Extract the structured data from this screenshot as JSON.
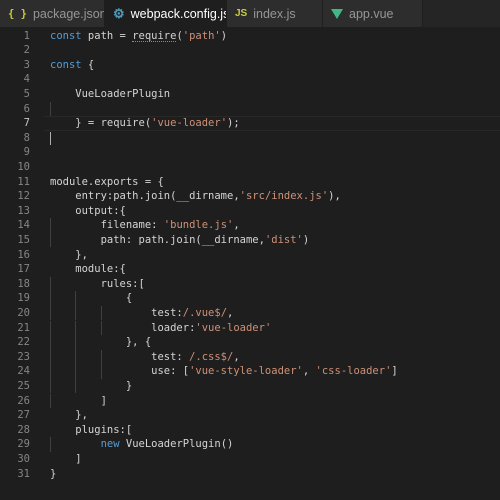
{
  "tabs": [
    {
      "label": "package.json",
      "icon": "{ }",
      "icon_name": "json-icon",
      "active": false
    },
    {
      "label": "webpack.config.js",
      "icon": "⚙",
      "icon_name": "gear-icon",
      "active": true
    },
    {
      "label": "index.js",
      "icon": "JS",
      "icon_name": "js-icon",
      "active": false
    },
    {
      "label": "app.vue",
      "icon": "",
      "icon_name": "vue-icon",
      "active": false
    }
  ],
  "editor": {
    "current_line": 7,
    "lines": [
      [
        [
          "kw",
          "const"
        ],
        [
          "pl",
          " path = "
        ],
        [
          "pl",
          "require"
        ],
        [
          "pl",
          "("
        ],
        [
          "str",
          "'path'"
        ],
        [
          "pl",
          ")"
        ]
      ],
      [],
      [
        [
          "kw",
          "const"
        ],
        [
          "pl",
          " {"
        ]
      ],
      [],
      [
        [
          "pl",
          "    VueLoaderPlugin"
        ]
      ],
      [],
      [
        [
          "pl",
          "    } = require("
        ],
        [
          "str",
          "'vue-loader'"
        ],
        [
          "pl",
          ");"
        ]
      ],
      [],
      [],
      [],
      [
        [
          "pl",
          "module.exports = {"
        ]
      ],
      [
        [
          "pl",
          "    entry:path.join(__dirname,"
        ],
        [
          "str",
          "'src/index.js'"
        ],
        [
          "pl",
          "),"
        ]
      ],
      [
        [
          "pl",
          "    output:{"
        ]
      ],
      [
        [
          "pl",
          "        filename: "
        ],
        [
          "str",
          "'bundle.js'"
        ],
        [
          "pl",
          ","
        ]
      ],
      [
        [
          "pl",
          "        path: path.join(__dirname,"
        ],
        [
          "str",
          "'dist'"
        ],
        [
          "pl",
          ")"
        ]
      ],
      [
        [
          "pl",
          "    },"
        ]
      ],
      [
        [
          "pl",
          "    module:{"
        ]
      ],
      [
        [
          "pl",
          "        rules:["
        ]
      ],
      [
        [
          "pl",
          "            {"
        ]
      ],
      [
        [
          "pl",
          "                test:"
        ],
        [
          "str",
          "/.vue$/"
        ],
        [
          "pl",
          ","
        ]
      ],
      [
        [
          "pl",
          "                loader:"
        ],
        [
          "str",
          "'vue-loader'"
        ]
      ],
      [
        [
          "pl",
          "            }, {"
        ]
      ],
      [
        [
          "pl",
          "                test: "
        ],
        [
          "str",
          "/.css$/"
        ],
        [
          "pl",
          ","
        ]
      ],
      [
        [
          "pl",
          "                use: ["
        ],
        [
          "str",
          "'vue-style-loader'"
        ],
        [
          "pl",
          ", "
        ],
        [
          "str",
          "'css-loader'"
        ],
        [
          "pl",
          "]"
        ]
      ],
      [
        [
          "pl",
          "            }"
        ]
      ],
      [
        [
          "pl",
          "        ]"
        ]
      ],
      [
        [
          "pl",
          "    },"
        ]
      ],
      [
        [
          "pl",
          "    plugins:["
        ]
      ],
      [
        [
          "pl",
          "        "
        ],
        [
          "kw",
          "new"
        ],
        [
          "pl",
          " VueLoaderPlugin()"
        ]
      ],
      [
        [
          "pl",
          "    ]"
        ]
      ],
      [
        [
          "pl",
          "}"
        ]
      ]
    ]
  }
}
